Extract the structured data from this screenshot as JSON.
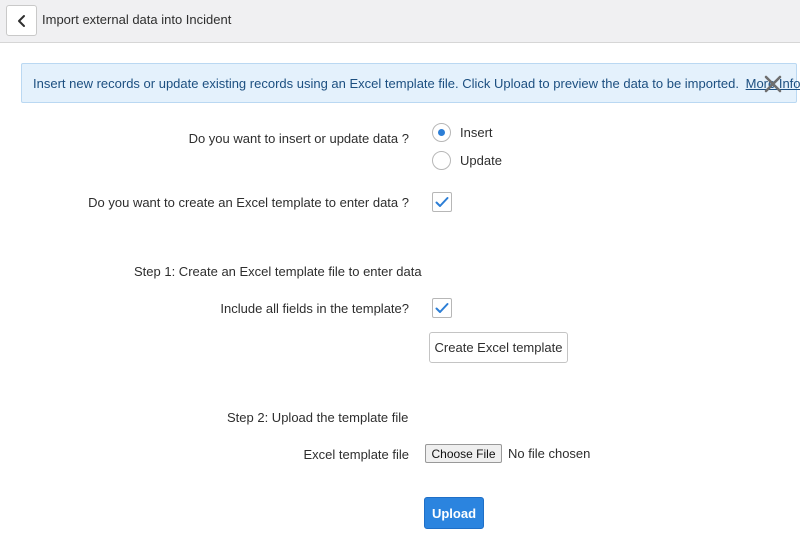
{
  "header": {
    "title": "Import external data into Incident",
    "back_icon": "chevron-left-icon"
  },
  "banner": {
    "text": "Insert new records or update existing records using an Excel template file. Click Upload to preview the data to be imported.",
    "link": "More Info",
    "close_icon": "close-icon"
  },
  "form": {
    "insert_update_question": "Do you want to insert or update data ?",
    "options": [
      {
        "label": "Insert",
        "selected": true
      },
      {
        "label": "Update",
        "selected": false
      }
    ],
    "create_template_question": "Do you want to create an Excel template to enter data ?",
    "create_template_checked": true,
    "step1_label": "Step   1:  Create an Excel template file to enter data",
    "include_all_fields_label": "Include all fields in the template?",
    "include_all_fields_checked": true,
    "create_template_button": "Create Excel template",
    "step2_label": "Step   2:   Upload the template file",
    "template_file_label": "Excel template file",
    "choose_file_button": "Choose File",
    "file_status": "No file chosen",
    "upload_button": "Upload"
  },
  "colors": {
    "accent": "#2b84df",
    "banner_bg": "#e4f1fc",
    "banner_text": "#1c4f80",
    "check": "#2c7ed6"
  }
}
